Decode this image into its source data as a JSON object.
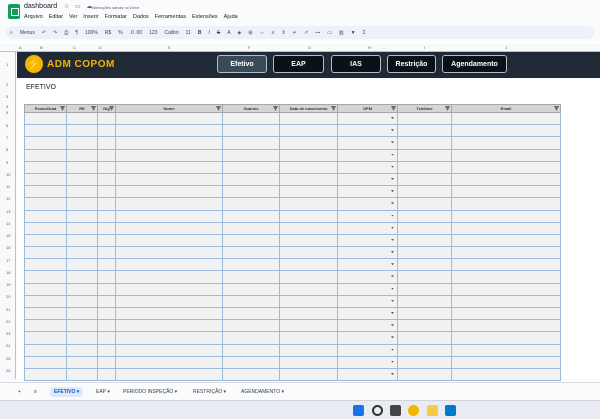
{
  "app": {
    "doc_title": "dashboard",
    "saved_status": "Alterações salvas no Drive",
    "menu": [
      "Arquivo",
      "Editar",
      "Ver",
      "Inserir",
      "Formatar",
      "Dados",
      "Ferramentas",
      "Extensões",
      "Ajuda"
    ]
  },
  "toolbar": {
    "menus": "Menus",
    "zoom": "100%",
    "currency": "R$",
    "percent": "%",
    "decimals": ".0  .00",
    "number_format": "123",
    "font": "Calibri",
    "font_size": "11",
    "bold": "B",
    "italic": "I",
    "strike": "S",
    "text_color": "A",
    "sum": "Σ"
  },
  "columns": [
    "A",
    "B",
    "C",
    "D",
    "E",
    "F",
    "G",
    "H",
    "I",
    "J"
  ],
  "rows": [
    "1",
    "2",
    "3",
    "4",
    "5",
    "6",
    "7",
    "8",
    "9",
    "10",
    "11",
    "12",
    "13",
    "14",
    "15",
    "16",
    "17",
    "18",
    "19",
    "20",
    "21",
    "22",
    "23",
    "24",
    "25",
    "26"
  ],
  "banner": {
    "bolt": "⚡",
    "title": "ADM COPOM",
    "nav": [
      "Efetivo",
      "EAP",
      "IAS",
      "Restrição",
      "Agendamento"
    ]
  },
  "section_title": "EFETIVO",
  "table_headers": [
    "Posto/Grad",
    "RE",
    "Dig",
    "Nome",
    "Guarnic",
    "Data de nascimento",
    "OPM",
    "Telefone",
    "Email"
  ],
  "tabs": {
    "add": "+",
    "list": "≡",
    "items": [
      "EFETIVO",
      "EAP",
      "PERIODO INSPEÇÃO",
      "RESTRIÇÃO",
      "AGENDAMENTO"
    ]
  }
}
